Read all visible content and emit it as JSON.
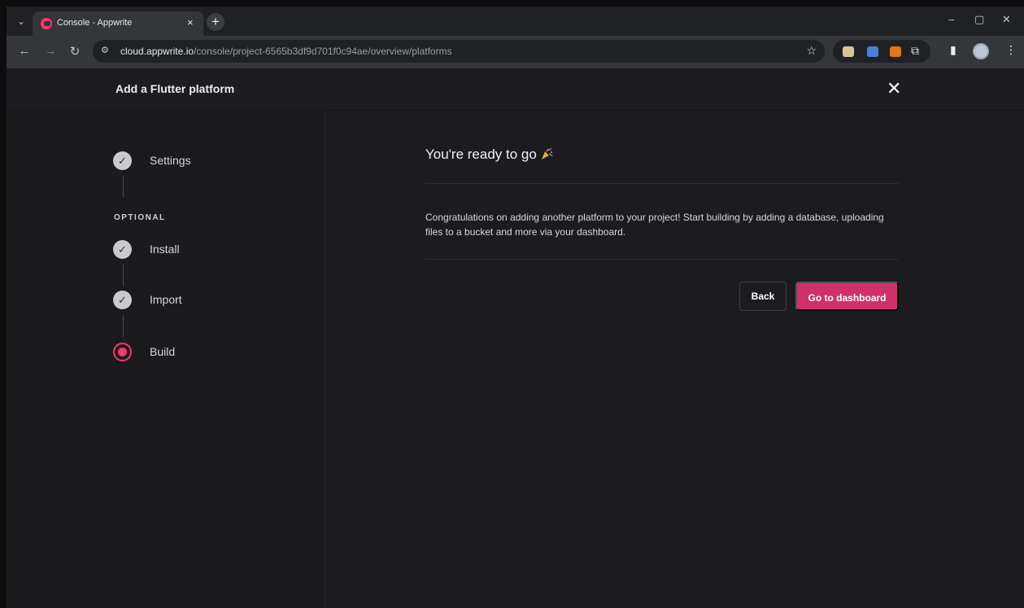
{
  "browser": {
    "tab_title": "Console - Appwrite",
    "tab_close": "×",
    "new_tab": "+",
    "url_host": "cloud.appwrite.io",
    "url_path": "/console/project-6565b3df9d701f0c94ae/overview/platforms",
    "nav_icons": [
      "back-arrow-icon",
      "forward-arrow-icon",
      "reload-icon"
    ],
    "window_controls": [
      "–",
      "▢",
      "✕"
    ],
    "colors": {
      "tabstrip": "#202124",
      "toolbar": "#35363a",
      "favicon": "#fd366e"
    }
  },
  "header": {
    "title": "Add a Flutter platform",
    "close": "✕"
  },
  "steps": {
    "settings": {
      "label": "Settings",
      "check": "✓"
    },
    "optional_label": "OPTIONAL",
    "install": {
      "label": "Install",
      "check": "✓"
    },
    "import": {
      "label": "Import",
      "check": "✓"
    },
    "build": {
      "label": "Build"
    }
  },
  "main": {
    "heading": "You're ready to go",
    "message": "Congratulations on adding another platform to your project! Start building by adding a database, uploading files to a bucket and more via your dashboard.",
    "back_label": "Back",
    "dashboard_label": "Go to dashboard"
  },
  "theme": {
    "accent": "#fd366e",
    "primary_button": "#d0306a",
    "background": "#1d1d21"
  }
}
